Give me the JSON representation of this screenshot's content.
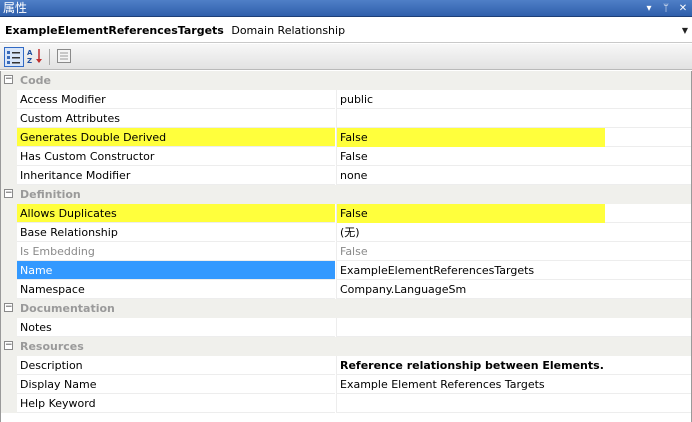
{
  "window": {
    "title": "属性",
    "buttons": [
      "▾",
      "ᛘ",
      "✕"
    ]
  },
  "selector": {
    "object_name": "ExampleElementReferencesTargets",
    "object_type": "Domain Relationship"
  },
  "toolbar": {
    "buttons": [
      "categorized",
      "alphabetical",
      "property-pages"
    ]
  },
  "grid": {
    "categories": [
      {
        "label": "Code",
        "properties": [
          {
            "name": "Access Modifier",
            "value": "public"
          },
          {
            "name": "Custom Attributes",
            "value": ""
          },
          {
            "name": "Generates Double Derived",
            "value": "False",
            "highlighted": true
          },
          {
            "name": "Has Custom Constructor",
            "value": "False"
          },
          {
            "name": "Inheritance Modifier",
            "value": "none"
          }
        ]
      },
      {
        "label": "Definition",
        "properties": [
          {
            "name": "Allows Duplicates",
            "value": "False",
            "highlighted": true
          },
          {
            "name": "Base Relationship",
            "value": "(无)"
          },
          {
            "name": "Is Embedding",
            "value": "False",
            "disabled": true
          },
          {
            "name": "Name",
            "value": "ExampleElementReferencesTargets",
            "selected": true
          },
          {
            "name": "Namespace",
            "value": "Company.LanguageSm"
          }
        ]
      },
      {
        "label": "Documentation",
        "properties": [
          {
            "name": "Notes",
            "value": ""
          }
        ]
      },
      {
        "label": "Resources",
        "properties": [
          {
            "name": "Description",
            "value": "Reference relationship between Elements.",
            "bold": true
          },
          {
            "name": "Display Name",
            "value": "Example Element References Targets"
          },
          {
            "name": "Help Keyword",
            "value": ""
          }
        ]
      }
    ]
  },
  "colors": {
    "highlight": "#ffff3c",
    "selection": "#3399ff",
    "category_bg": "#f0f0ec",
    "title_bar": "#3a6ab8"
  }
}
